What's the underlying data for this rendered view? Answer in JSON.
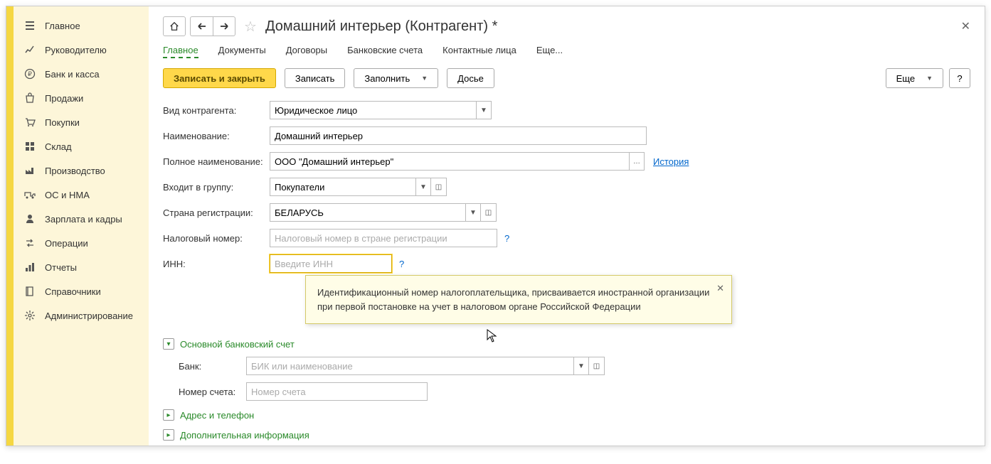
{
  "sidebar": {
    "items": [
      {
        "label": "Главное",
        "icon": "menu"
      },
      {
        "label": "Руководителю",
        "icon": "chart"
      },
      {
        "label": "Банк и касса",
        "icon": "ruble"
      },
      {
        "label": "Продажи",
        "icon": "bag"
      },
      {
        "label": "Покупки",
        "icon": "cart"
      },
      {
        "label": "Склад",
        "icon": "boxes"
      },
      {
        "label": "Производство",
        "icon": "factory"
      },
      {
        "label": "ОС и НМА",
        "icon": "truck"
      },
      {
        "label": "Зарплата и кадры",
        "icon": "person"
      },
      {
        "label": "Операции",
        "icon": "transfer"
      },
      {
        "label": "Отчеты",
        "icon": "bars"
      },
      {
        "label": "Справочники",
        "icon": "book"
      },
      {
        "label": "Администрирование",
        "icon": "gear"
      }
    ]
  },
  "header": {
    "title": "Домашний интерьер (Контрагент) *"
  },
  "tabs": [
    {
      "label": "Главное",
      "active": true
    },
    {
      "label": "Документы"
    },
    {
      "label": "Договоры"
    },
    {
      "label": "Банковские счета"
    },
    {
      "label": "Контактные лица"
    },
    {
      "label": "Еще..."
    }
  ],
  "toolbar": {
    "save_close": "Записать и закрыть",
    "save": "Записать",
    "fill": "Заполнить",
    "dossier": "Досье",
    "more": "Еще",
    "help": "?"
  },
  "form": {
    "type_label": "Вид контрагента:",
    "type_value": "Юридическое лицо",
    "name_label": "Наименование:",
    "name_value": "Домашний интерьер",
    "fullname_label": "Полное наименование:",
    "fullname_value": "ООО \"Домашний интерьер\"",
    "history_link": "История",
    "group_label": "Входит в группу:",
    "group_value": "Покупатели",
    "country_label": "Страна регистрации:",
    "country_value": "БЕЛАРУСЬ",
    "taxnum_label": "Налоговый номер:",
    "taxnum_placeholder": "Налоговый номер в стране регистрации",
    "inn_label": "ИНН:",
    "inn_placeholder": "Введите ИНН",
    "bank_section": "Основной банковский счет",
    "bank_label": "Банк:",
    "bank_placeholder": "БИК или наименование",
    "account_label": "Номер счета:",
    "account_placeholder": "Номер счета",
    "address_section": "Адрес и телефон",
    "addinfo_section": "Дополнительная информация"
  },
  "tooltip": {
    "text": "Идентификационный номер налогоплательщика, присваивается иностранной организации при первой постановке на учет в налоговом органе Российской Федерации"
  }
}
